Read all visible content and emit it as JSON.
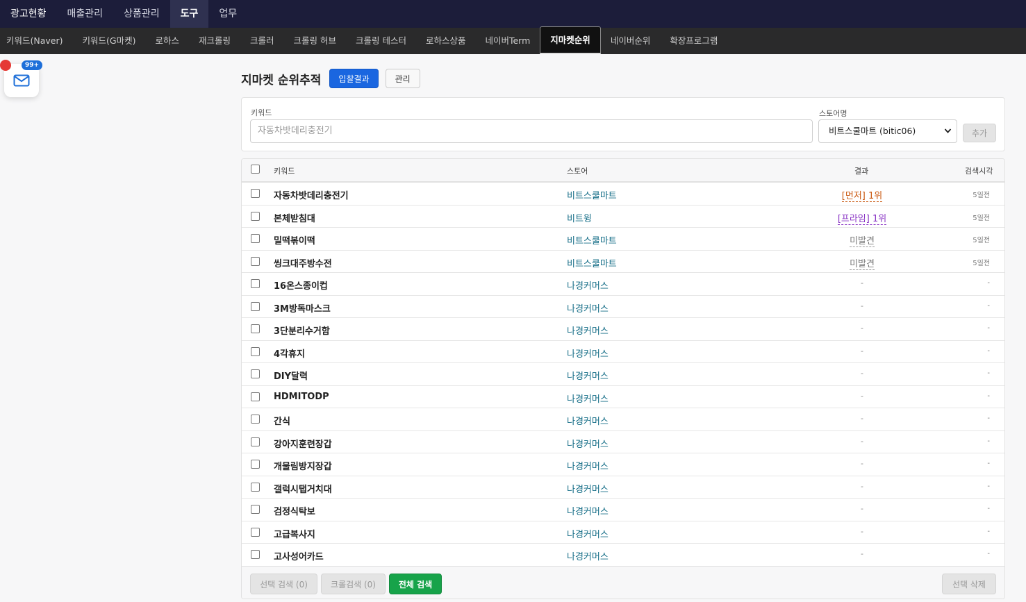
{
  "top_nav": [
    "광고현황",
    "매출관리",
    "상품관리",
    "도구",
    "업무"
  ],
  "top_nav_active": "도구",
  "sub_nav": [
    "키워드(Naver)",
    "키워드(G마켓)",
    "로하스",
    "재크롤링",
    "크롤러",
    "크롤링 허브",
    "크롤링 테스터",
    "로하스상품",
    "네이버Term",
    "지마켓순위",
    "네이버순위",
    "확장프로그램"
  ],
  "sub_nav_active": "지마켓순위",
  "mail_widget": {
    "badge": "99+",
    "icon": "mail-icon"
  },
  "header": {
    "title": "지마켓 순위추적",
    "btn_results": "입찰결과",
    "btn_manage": "관리"
  },
  "form": {
    "keyword_label": "키워드",
    "keyword_placeholder": "자동차밧데리충전기",
    "store_label": "스토어명",
    "store_selected": "비트스쿨마트 (bitic06)",
    "add_button": "추가"
  },
  "table": {
    "headers": {
      "keyword": "키워드",
      "store": "스토어",
      "result": "결과",
      "time": "검색시각"
    },
    "rows": [
      {
        "keyword": "자동차밧데리충전기",
        "store": "비트스쿨마트",
        "result": "[먼저] 1위",
        "result_type": "orange",
        "time": "5일전"
      },
      {
        "keyword": "본체받침대",
        "store": "비트윙",
        "result": "[프라임] 1위",
        "result_type": "purple",
        "time": "5일전"
      },
      {
        "keyword": "밀떡볶이떡",
        "store": "비트스쿨마트",
        "result": "미발견",
        "result_type": "gray",
        "time": "5일전"
      },
      {
        "keyword": "씽크대주방수전",
        "store": "비트스쿨마트",
        "result": "미발견",
        "result_type": "gray",
        "time": "5일전"
      },
      {
        "keyword": "16온스종이컵",
        "store": "나경커머스",
        "result": "-",
        "result_type": "dash",
        "time": "-"
      },
      {
        "keyword": "3M방독마스크",
        "store": "나경커머스",
        "result": "-",
        "result_type": "dash",
        "time": "-"
      },
      {
        "keyword": "3단분리수거함",
        "store": "나경커머스",
        "result": "-",
        "result_type": "dash",
        "time": "-"
      },
      {
        "keyword": "4각휴지",
        "store": "나경커머스",
        "result": "-",
        "result_type": "dash",
        "time": "-"
      },
      {
        "keyword": "DIY달력",
        "store": "나경커머스",
        "result": "-",
        "result_type": "dash",
        "time": "-"
      },
      {
        "keyword": "HDMITODP",
        "store": "나경커머스",
        "result": "-",
        "result_type": "dash",
        "time": "-"
      },
      {
        "keyword": "간식",
        "store": "나경커머스",
        "result": "-",
        "result_type": "dash",
        "time": "-"
      },
      {
        "keyword": "강아지훈련장갑",
        "store": "나경커머스",
        "result": "-",
        "result_type": "dash",
        "time": "-"
      },
      {
        "keyword": "개물림방지장갑",
        "store": "나경커머스",
        "result": "-",
        "result_type": "dash",
        "time": "-"
      },
      {
        "keyword": "갤럭시탭거치대",
        "store": "나경커머스",
        "result": "-",
        "result_type": "dash",
        "time": "-"
      },
      {
        "keyword": "검정식탁보",
        "store": "나경커머스",
        "result": "-",
        "result_type": "dash",
        "time": "-"
      },
      {
        "keyword": "고급복사지",
        "store": "나경커머스",
        "result": "-",
        "result_type": "dash",
        "time": "-"
      },
      {
        "keyword": "고사성어카드",
        "store": "나경커머스",
        "result": "-",
        "result_type": "dash",
        "time": "-"
      }
    ]
  },
  "footer": {
    "btn_selected_search": "선택 검색 (0)",
    "btn_crawl_search": "크롤검색 (0)",
    "btn_search_all": "전체 검색",
    "btn_delete_selected": "선택 삭제"
  },
  "colors": {
    "topnav_bg": "#1c1d3a",
    "subnav_bg": "#2a2a2b",
    "primary": "#1a66e0",
    "green": "#17a34a",
    "store_link": "#136c86"
  }
}
